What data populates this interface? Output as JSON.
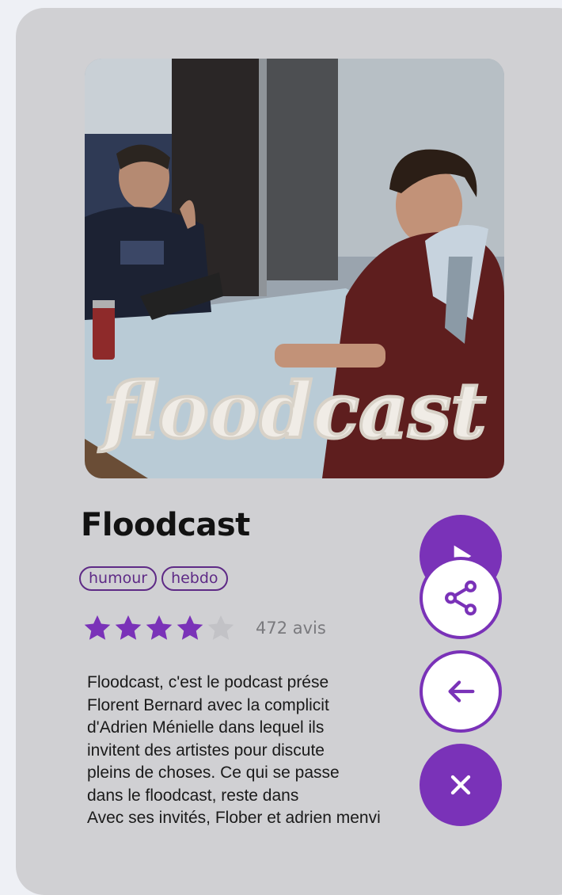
{
  "podcast": {
    "title": "Floodcast",
    "cover_text": "floodcast",
    "tags": [
      "humour",
      "hebdo"
    ],
    "rating": 4,
    "rating_max": 5,
    "reviews_label": "472 avis",
    "description_lines": [
      "Floodcast, c'est le podcast prése",
      "Florent Bernard avec la complicit",
      "d'Adrien Ménielle dans lequel ils",
      "invitent des artistes pour discute",
      "pleins de choses. Ce qui se passe",
      "dans le floodcast, reste dans",
      "Avec ses invités, Flober et adrien menvi"
    ]
  },
  "actions": [
    {
      "name": "play",
      "icon": "play-icon"
    },
    {
      "name": "share",
      "icon": "share-icon"
    },
    {
      "name": "back",
      "icon": "arrow-left-icon"
    },
    {
      "name": "close",
      "icon": "close-icon"
    }
  ],
  "colors": {
    "accent": "#7a32b8",
    "tag": "#5e2a86",
    "card_bg": "#d0d0d3",
    "star_empty": "#c2c2c6"
  }
}
